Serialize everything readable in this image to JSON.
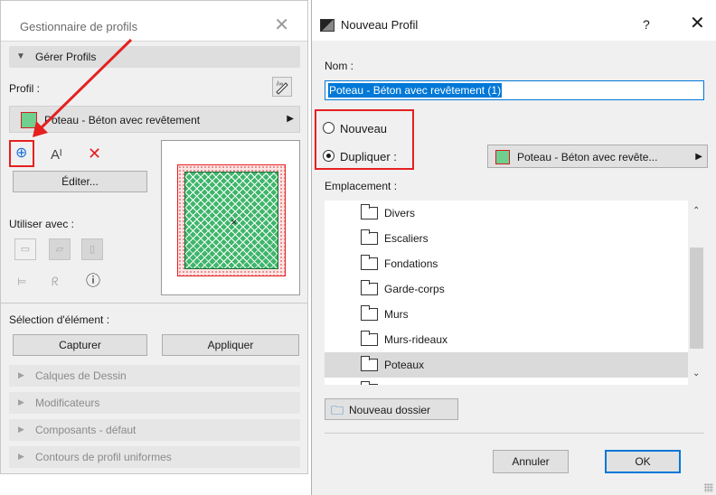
{
  "left_panel": {
    "title": "Gestionnaire de profils",
    "manage_section": "Gérer Profils",
    "profile_label": "Profil :",
    "profile_name": "Poteau - Béton avec revêtement",
    "edit_button": "Éditer...",
    "use_with_label": "Utiliser avec :",
    "info_glyph": "ⓘ",
    "element_selection_label": "Sélection d'élément :",
    "capture_button": "Capturer",
    "apply_button": "Appliquer",
    "collapsed_sections": [
      "Calques de Dessin",
      "Modificateurs",
      "Composants - défaut",
      "Contours de profil uniformes"
    ]
  },
  "dialog": {
    "title": "Nouveau Profil",
    "help": "?",
    "name_label": "Nom :",
    "name_value": "Poteau - Béton avec revêtement (1)",
    "radio_new": "Nouveau",
    "radio_duplicate": "Dupliquer :",
    "selected_radio": "duplicate",
    "duplicate_source": "Poteau - Béton avec revête...",
    "location_label": "Emplacement :",
    "folders": [
      "Divers",
      "Escaliers",
      "Fondations",
      "Garde-corps",
      "Murs",
      "Murs-rideaux",
      "Poteaux"
    ],
    "selected_folder": "Poteaux",
    "new_folder_button": "Nouveau dossier",
    "cancel_button": "Annuler",
    "ok_button": "OK"
  },
  "colors": {
    "annotation_red": "#e52020",
    "accent_blue": "#0078d7",
    "hatch_green": "#3fb66b"
  },
  "icons": {
    "add_profile": "circle-plus-icon",
    "rename_profile": "rename-icon",
    "delete_profile": "red-x-icon"
  }
}
